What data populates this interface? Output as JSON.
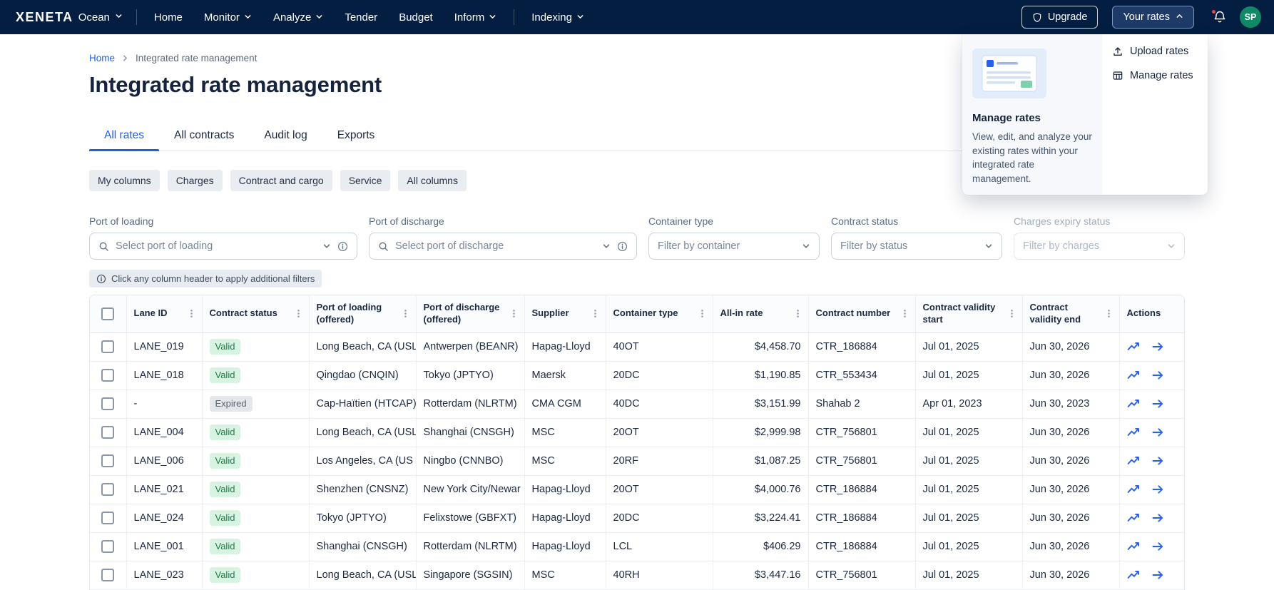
{
  "colors": {
    "nav_bg": "#041E42",
    "accent_blue": "#1A5EF6",
    "action_icon_blue": "#2563EB",
    "valid_badge_bg": "#D8F3E2",
    "valid_badge_text": "#1E7B45",
    "expired_badge_bg": "#E4E7EB",
    "expired_badge_text": "#5A6472",
    "avatar_bg": "#0F8A66",
    "notification_dot": "#E5484D"
  },
  "nav": {
    "brand": "XENETA",
    "product": "Ocean",
    "items": [
      {
        "label": "Home",
        "dropdown": false
      },
      {
        "label": "Monitor",
        "dropdown": true
      },
      {
        "label": "Analyze",
        "dropdown": true
      },
      {
        "label": "Tender",
        "dropdown": false
      },
      {
        "label": "Budget",
        "dropdown": false
      },
      {
        "label": "Inform",
        "dropdown": true
      },
      {
        "label": "Indexing",
        "dropdown": true
      }
    ],
    "upgrade_label": "Upgrade",
    "your_rates_label": "Your rates",
    "avatar_initials": "SP"
  },
  "your_rates_menu": {
    "items": [
      {
        "label": "Upload rates",
        "icon": "upload-icon"
      },
      {
        "label": "Manage rates",
        "icon": "manage-rates-icon"
      }
    ],
    "promo": {
      "title": "Manage rates",
      "description": "View, edit, and analyze your existing rates within your integrated rate management."
    }
  },
  "breadcrumb": {
    "home": "Home",
    "current": "Integrated rate management"
  },
  "page": {
    "title": "Integrated rate management"
  },
  "tabs": [
    {
      "label": "All rates",
      "active": true
    },
    {
      "label": "All contracts",
      "active": false
    },
    {
      "label": "Audit log",
      "active": false
    },
    {
      "label": "Exports",
      "active": false
    }
  ],
  "column_presets": [
    {
      "label": "My columns"
    },
    {
      "label": "Charges"
    },
    {
      "label": "Contract and cargo"
    },
    {
      "label": "Service"
    },
    {
      "label": "All columns"
    }
  ],
  "filters": [
    {
      "label": "Port of loading",
      "placeholder": "Select port of loading",
      "search": true,
      "info": true,
      "disabled": false
    },
    {
      "label": "Port of discharge",
      "placeholder": "Select port of discharge",
      "search": true,
      "info": true,
      "disabled": false
    },
    {
      "label": "Container type",
      "placeholder": "Filter by container",
      "search": false,
      "info": false,
      "disabled": false
    },
    {
      "label": "Contract status",
      "placeholder": "Filter by status",
      "search": false,
      "info": false,
      "disabled": false
    },
    {
      "label": "Charges expiry status",
      "placeholder": "Filter by charges",
      "search": false,
      "info": false,
      "disabled": true
    }
  ],
  "hint": "Click any column header to apply additional filters",
  "table": {
    "columns": [
      {
        "label": "Lane ID",
        "menu": true
      },
      {
        "label": "Contract status",
        "menu": true
      },
      {
        "label": "Port of loading (offered)",
        "menu": true
      },
      {
        "label": "Port of discharge (offered)",
        "menu": true
      },
      {
        "label": "Supplier",
        "menu": true
      },
      {
        "label": "Container type",
        "menu": true
      },
      {
        "label": "All-in rate",
        "menu": true
      },
      {
        "label": "Contract number",
        "menu": true
      },
      {
        "label": "Contract validity start",
        "menu": true
      },
      {
        "label": "Contract validity end",
        "menu": true
      },
      {
        "label": "Actions",
        "menu": false
      }
    ],
    "rows": [
      {
        "lane_id": "LANE_019",
        "status": "Valid",
        "status_type": "valid",
        "port_of_loading": "Long Beach, CA (USL",
        "port_of_discharge": "Antwerpen (BEANR)",
        "supplier": "Hapag-Lloyd",
        "container_type": "40OT",
        "all_in_rate": "$4,458.70",
        "contract_number": "CTR_186884",
        "validity_start": "Jul 01, 2025",
        "validity_end": "Jun 30, 2026"
      },
      {
        "lane_id": "LANE_018",
        "status": "Valid",
        "status_type": "valid",
        "port_of_loading": "Qingdao (CNQIN)",
        "port_of_discharge": "Tokyo (JPTYO)",
        "supplier": "Maersk",
        "container_type": "20DC",
        "all_in_rate": "$1,190.85",
        "contract_number": "CTR_553434",
        "validity_start": "Jul 01, 2025",
        "validity_end": "Jun 30, 2026"
      },
      {
        "lane_id": "-",
        "status": "Expired",
        "status_type": "expired",
        "port_of_loading": "Cap-Haïtien (HTCAP)",
        "port_of_discharge": "Rotterdam (NLRTM)",
        "supplier": "CMA CGM",
        "container_type": "40DC",
        "all_in_rate": "$3,151.99",
        "contract_number": "Shahab 2",
        "validity_start": "Apr 01, 2023",
        "validity_end": "Jun 30, 2023"
      },
      {
        "lane_id": "LANE_004",
        "status": "Valid",
        "status_type": "valid",
        "port_of_loading": "Long Beach, CA (USL",
        "port_of_discharge": "Shanghai (CNSGH)",
        "supplier": "MSC",
        "container_type": "20OT",
        "all_in_rate": "$2,999.98",
        "contract_number": "CTR_756801",
        "validity_start": "Jul 01, 2025",
        "validity_end": "Jun 30, 2026"
      },
      {
        "lane_id": "LANE_006",
        "status": "Valid",
        "status_type": "valid",
        "port_of_loading": "Los Angeles, CA (US",
        "port_of_discharge": "Ningbo (CNNBO)",
        "supplier": "MSC",
        "container_type": "20RF",
        "all_in_rate": "$1,087.25",
        "contract_number": "CTR_756801",
        "validity_start": "Jul 01, 2025",
        "validity_end": "Jun 30, 2026"
      },
      {
        "lane_id": "LANE_021",
        "status": "Valid",
        "status_type": "valid",
        "port_of_loading": "Shenzhen (CNSNZ)",
        "port_of_discharge": "New York City/Newar",
        "supplier": "Hapag-Lloyd",
        "container_type": "20OT",
        "all_in_rate": "$4,000.76",
        "contract_number": "CTR_186884",
        "validity_start": "Jul 01, 2025",
        "validity_end": "Jun 30, 2026"
      },
      {
        "lane_id": "LANE_024",
        "status": "Valid",
        "status_type": "valid",
        "port_of_loading": "Tokyo (JPTYO)",
        "port_of_discharge": "Felixstowe (GBFXT)",
        "supplier": "Hapag-Lloyd",
        "container_type": "20DC",
        "all_in_rate": "$3,224.41",
        "contract_number": "CTR_186884",
        "validity_start": "Jul 01, 2025",
        "validity_end": "Jun 30, 2026"
      },
      {
        "lane_id": "LANE_001",
        "status": "Valid",
        "status_type": "valid",
        "port_of_loading": "Shanghai (CNSGH)",
        "port_of_discharge": "Rotterdam (NLRTM)",
        "supplier": "Hapag-Lloyd",
        "container_type": "LCL",
        "all_in_rate": "$406.29",
        "contract_number": "CTR_186884",
        "validity_start": "Jul 01, 2025",
        "validity_end": "Jun 30, 2026"
      },
      {
        "lane_id": "LANE_023",
        "status": "Valid",
        "status_type": "valid",
        "port_of_loading": "Long Beach, CA (USL",
        "port_of_discharge": "Singapore (SGSIN)",
        "supplier": "MSC",
        "container_type": "40RH",
        "all_in_rate": "$3,447.16",
        "contract_number": "CTR_756801",
        "validity_start": "Jul 01, 2025",
        "validity_end": "Jun 30, 2026"
      }
    ]
  }
}
